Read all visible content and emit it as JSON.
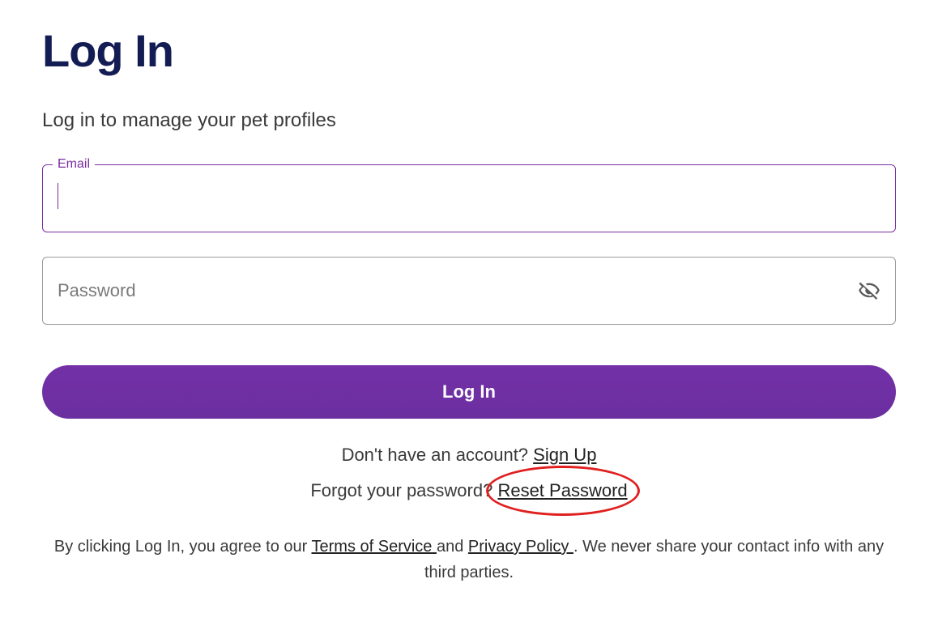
{
  "page": {
    "title": "Log In",
    "subtitle": "Log in to manage your pet profiles"
  },
  "form": {
    "email_label": "Email",
    "email_value": "",
    "password_placeholder": "Password",
    "password_value": "",
    "submit_label": "Log In"
  },
  "aux": {
    "signup_prompt": "Don't have an account? ",
    "signup_link": "Sign Up",
    "reset_prompt": "Forgot your password? ",
    "reset_link": "Reset Password"
  },
  "disclaimer": {
    "pre": "By clicking Log In, you agree to our ",
    "tos": "Terms of Service ",
    "mid": "and ",
    "privacy": "Privacy Policy ",
    "post": ". We never share your contact info with any third parties."
  }
}
